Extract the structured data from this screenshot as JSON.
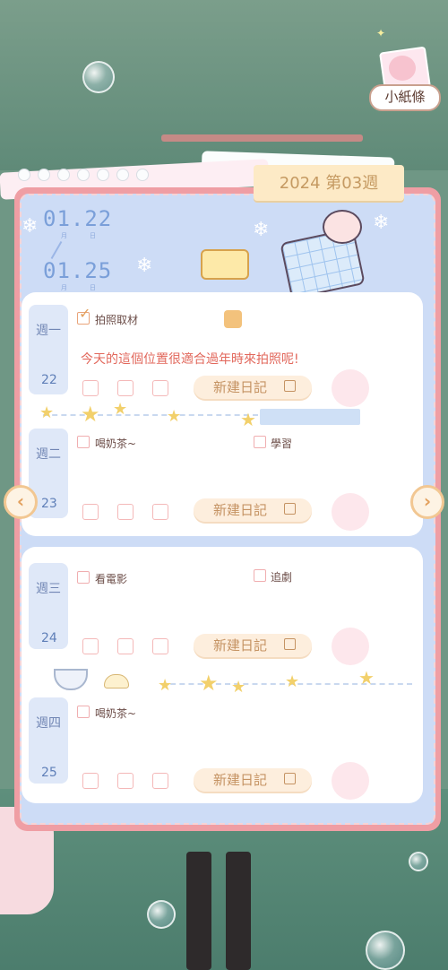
{
  "note_button": {
    "label": "小紙條"
  },
  "week_tag": "2024 第03週",
  "date_range": {
    "start": "01.22",
    "end": "01.25",
    "month_label": "月",
    "day_label": "日"
  },
  "days": [
    {
      "label": "週一",
      "num": "22",
      "tasks": [
        {
          "text": "拍照取材",
          "checked": true
        }
      ],
      "note": "今天的這個位置很適合過年時來拍照呢!",
      "new_diary": "新建日記"
    },
    {
      "label": "週二",
      "num": "23",
      "tasks": [
        {
          "text": "喝奶茶~",
          "checked": false
        },
        {
          "text": "學習",
          "checked": false
        }
      ],
      "new_diary": "新建日記"
    },
    {
      "label": "週三",
      "num": "24",
      "tasks": [
        {
          "text": "看電影",
          "checked": false
        },
        {
          "text": "追劇",
          "checked": false
        }
      ],
      "new_diary": "新建日記"
    },
    {
      "label": "週四",
      "num": "25",
      "tasks": [
        {
          "text": "喝奶茶~",
          "checked": false
        }
      ],
      "new_diary": "新建日記"
    }
  ],
  "nav": {
    "prev": "‹",
    "next": "›"
  },
  "colors": {
    "frame": "#ef9ea4",
    "accent": "#c59363",
    "note_text": "#e2685c",
    "day_text": "#7186b4"
  },
  "icons": [
    "gift-icon",
    "pen-icon",
    "checkmark-icon",
    "star-icon",
    "snowflake-icon",
    "arrow-left-icon",
    "arrow-right-icon"
  ]
}
